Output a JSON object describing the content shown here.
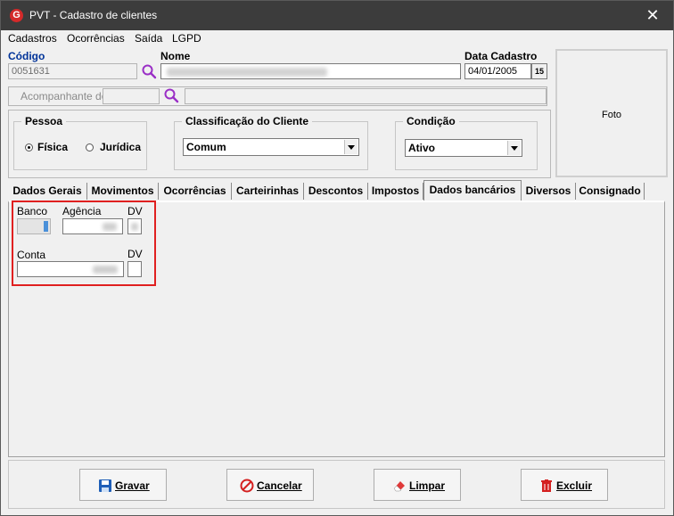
{
  "window": {
    "title": "PVT - Cadastro de clientes",
    "close": "✕",
    "app_icon": "G"
  },
  "menu": [
    "Cadastros",
    "Ocorrências",
    "Saída",
    "LGPD"
  ],
  "header": {
    "codigo_label": "Código",
    "codigo_value": "0051631",
    "nome_label": "Nome",
    "nome_value": "",
    "data_label": "Data Cadastro",
    "data_value": "04/01/2005",
    "acompanhante_placeholder": "Acompanhante de",
    "calendar_icon_text": "15"
  },
  "photo": {
    "label": "Foto"
  },
  "pessoa": {
    "title": "Pessoa",
    "options": [
      "Física",
      "Jurídica"
    ],
    "selected": "Física"
  },
  "classificacao": {
    "title": "Classificação do Cliente",
    "value": "Comum"
  },
  "condicao": {
    "title": "Condição",
    "value": "Ativo"
  },
  "tabs": [
    "Dados Gerais",
    "Movimentos",
    "Ocorrências",
    "Carteirinhas",
    "Descontos",
    "Impostos",
    "Dados bancários",
    "Diversos",
    "Consignado"
  ],
  "active_tab": "Dados bancários",
  "bank": {
    "banco_label": "Banco",
    "agencia_label": "Agência",
    "dv_label": "DV",
    "conta_label": "Conta",
    "conta_dv_label": "DV"
  },
  "buttons": {
    "gravar": "Gravar",
    "cancelar": "Cancelar",
    "limpar": "Limpar",
    "excluir": "Excluir"
  },
  "colors": {
    "titlebar": "#3c3c3c",
    "highlight": "#e02020",
    "accent": "#003399"
  }
}
